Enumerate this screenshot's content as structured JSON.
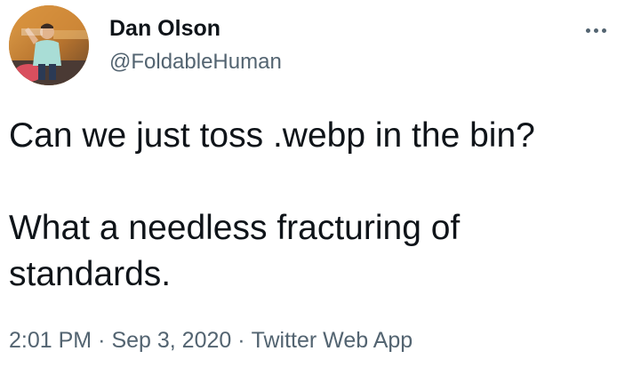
{
  "author": {
    "display_name": "Dan Olson",
    "handle": "@FoldableHuman"
  },
  "more_icon": "more-horizontal-icon",
  "tweet": {
    "text": "Can we just toss .webp in the bin?\n\nWhat a needless fracturing of\nstandards."
  },
  "meta": {
    "time": "2:01 PM",
    "separator": "·",
    "date": "Sep 3, 2020",
    "source": "Twitter Web App"
  },
  "colors": {
    "text_primary": "#0f1419",
    "text_secondary": "#536471",
    "background": "#ffffff"
  }
}
